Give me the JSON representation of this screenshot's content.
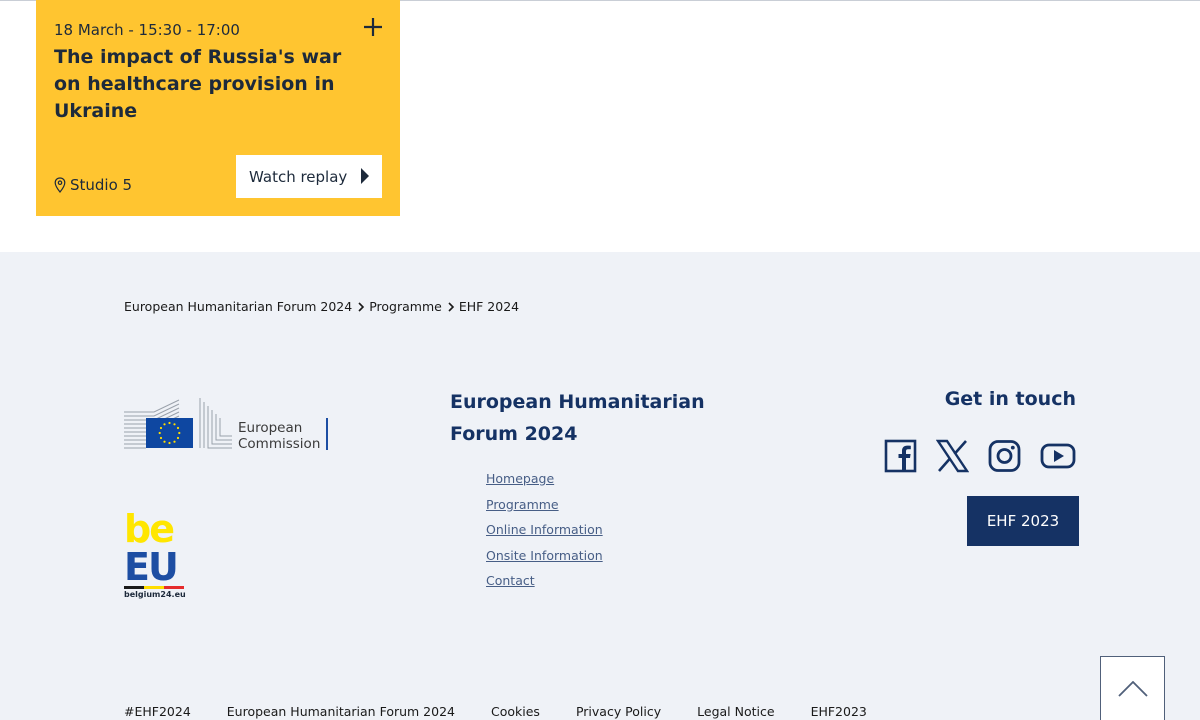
{
  "event": {
    "date": "18 March - 15:30 - 17:00",
    "title": "The impact of Russia's war on healthcare provision in Ukraine",
    "location": "Studio 5",
    "watch_label": "Watch replay",
    "card_color": "#ffc530",
    "expand_icon": "plus-icon",
    "location_icon": "map-pin-icon"
  },
  "breadcrumb": [
    "European Humanitarian Forum 2024",
    "Programme",
    "EHF 2024"
  ],
  "logos": {
    "ec_line1": "European",
    "ec_line2": "Commission",
    "beeu_top": "be",
    "beeu_bottom": "EU",
    "beeu_url": "belgium24.eu"
  },
  "forum": {
    "title": "European Humanitarian Forum 2024",
    "links": [
      "Homepage",
      "Programme",
      "Online Information",
      "Onsite Information",
      "Contact"
    ]
  },
  "contact": {
    "title": "Get in touch",
    "social": [
      "facebook-icon",
      "x-icon",
      "instagram-icon",
      "youtube-icon"
    ],
    "button": "EHF 2023"
  },
  "bottom_links": [
    "#EHF2024",
    "European Humanitarian Forum 2024",
    "Cookies",
    "Privacy Policy",
    "Legal Notice",
    "EHF2023"
  ],
  "colors": {
    "brand_navy": "#153264",
    "footer_bg": "#eff2f7",
    "link": "#475e86"
  }
}
